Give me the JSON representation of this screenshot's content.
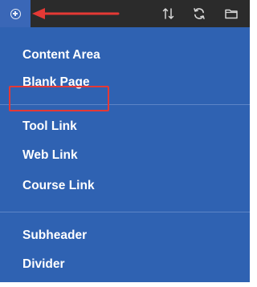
{
  "toolbar": {
    "icons": {
      "add": "plus-circle-icon",
      "sort": "sort-arrows-icon",
      "refresh": "refresh-icon",
      "folder": "folder-icon"
    }
  },
  "annotation": {
    "arrow_color": "#e53935",
    "highlight_color": "#e53935"
  },
  "menu": {
    "background": "#2f62b2",
    "items": [
      {
        "label": "Content Area"
      },
      {
        "label": "Blank Page"
      },
      {
        "label": "Tool Link"
      },
      {
        "label": "Web Link"
      },
      {
        "label": "Course Link"
      },
      {
        "label": "Subheader"
      },
      {
        "label": "Divider"
      }
    ]
  }
}
